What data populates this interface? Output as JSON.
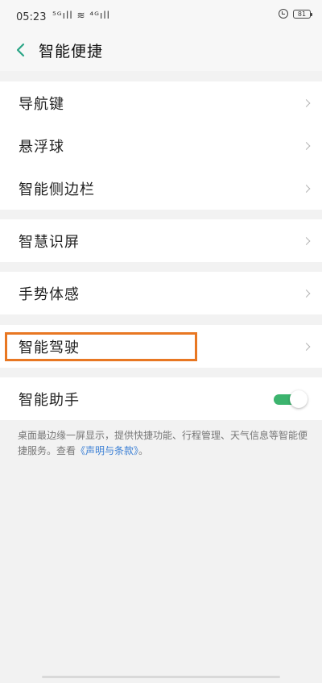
{
  "status_bar": {
    "time": "05:23",
    "signal": "⁵ᴳıll ≋ ⁴ᴳıll",
    "battery": "81",
    "icons": [
      "signal-icon",
      "wifi-icon",
      "alarm-icon",
      "battery-icon"
    ]
  },
  "header": {
    "title": "智能便捷",
    "back_icon": "chevron-left-icon"
  },
  "groups": [
    {
      "items": [
        {
          "label": "导航键"
        },
        {
          "label": "悬浮球"
        },
        {
          "label": "智能侧边栏"
        }
      ]
    },
    {
      "items": [
        {
          "label": "智慧识屏"
        }
      ]
    },
    {
      "items": [
        {
          "label": "手势体感"
        }
      ]
    },
    {
      "items": [
        {
          "label": "智能驾驶"
        }
      ]
    },
    {
      "items": [
        {
          "label": "智能助手",
          "toggle": true
        }
      ]
    }
  ],
  "description": {
    "text": "桌面最边缘一屏显示，提供快捷功能、行程管理、天气信息等智能便捷服务。查看",
    "link": "《声明与条款》",
    "suffix": "。"
  },
  "colors": {
    "accent": "#3cb46e",
    "back_arrow": "#2aa586",
    "highlight": "#e87722",
    "link": "#3a7fd5"
  }
}
